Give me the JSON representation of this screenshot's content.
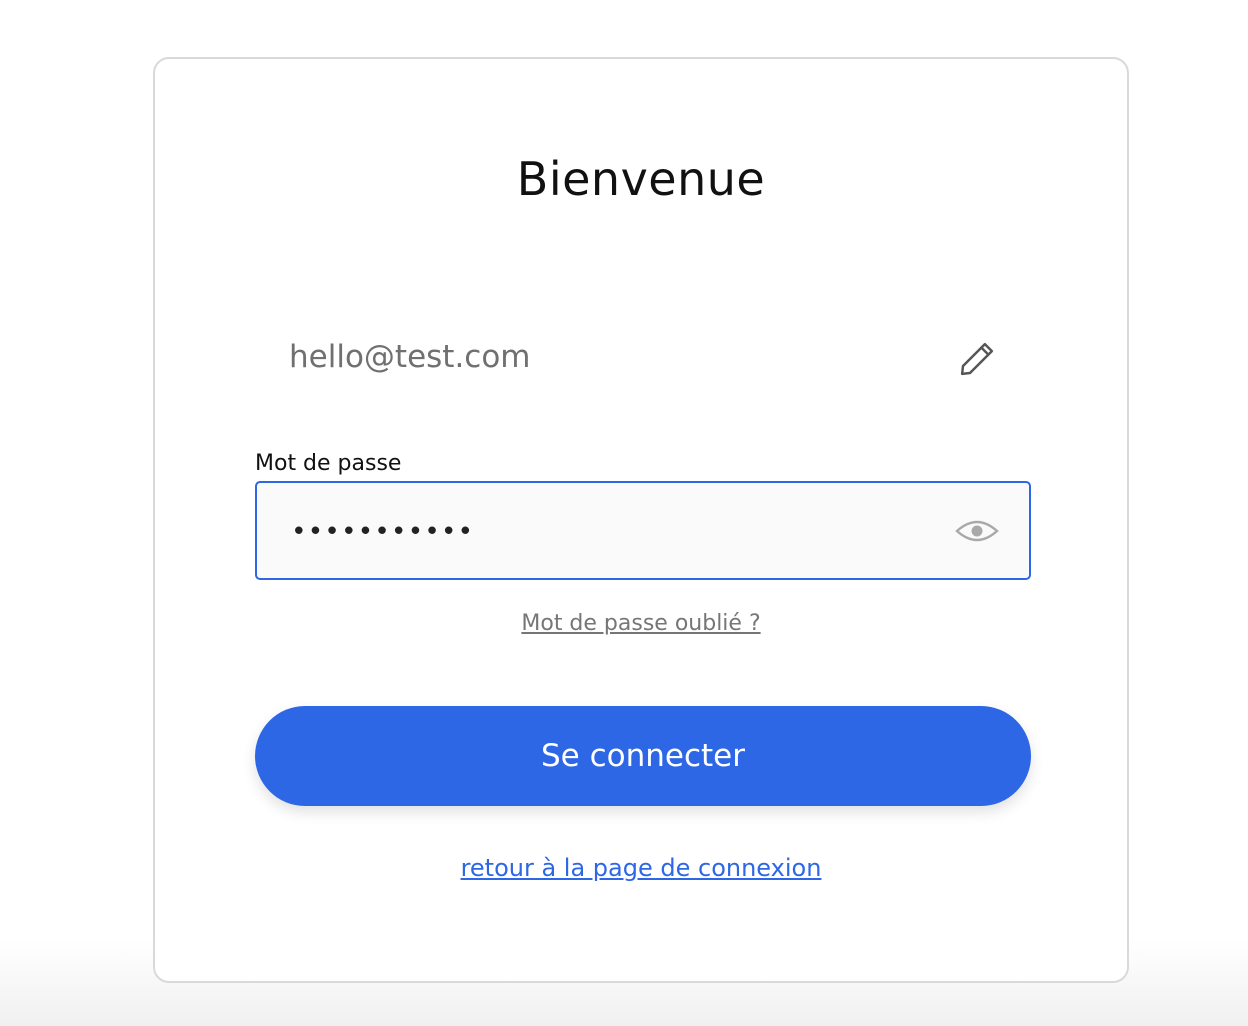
{
  "card": {
    "title": "Bienvenue"
  },
  "email": {
    "value": "hello@test.com",
    "edit_icon": "pencil-icon"
  },
  "password": {
    "label": "Mot de passe",
    "value": "passwordxyz",
    "toggle_icon": "eye-icon"
  },
  "links": {
    "forgot": "Mot de passe oublié ?",
    "back": "retour à la page de connexion"
  },
  "submit": {
    "label": "Se connecter"
  },
  "colors": {
    "accent": "#2d67e6",
    "border": "#d9d9d9",
    "muted_text": "#767676"
  }
}
